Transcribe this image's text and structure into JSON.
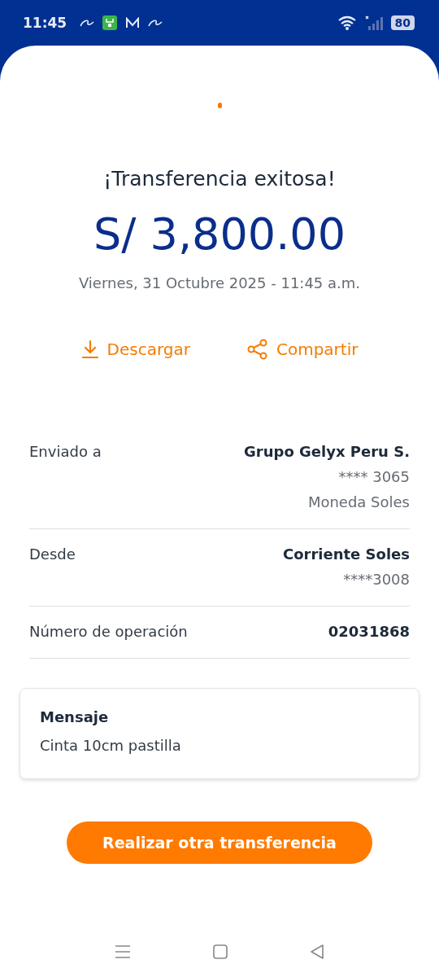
{
  "status_bar": {
    "time": "11:45",
    "battery": "80"
  },
  "title": "¡Transferencia exitosa!",
  "amount": "S/ 3,800.00",
  "date": "Viernes, 31 Octubre 2025 - 11:45 a.m.",
  "actions": [
    {
      "kind": "download",
      "label": "Descargar"
    },
    {
      "kind": "share",
      "label": "Compartir"
    }
  ],
  "details": [
    {
      "label": "Enviado a",
      "values": [
        "Grupo Gelyx Peru S.",
        "**** 3065",
        "Moneda Soles"
      ]
    },
    {
      "label": "Desde",
      "values": [
        "Corriente Soles",
        "****3008"
      ]
    },
    {
      "label": "Número de operación",
      "values": [
        "02031868"
      ]
    }
  ],
  "message": {
    "heading": "Mensaje",
    "text": "Cinta 10cm pastilla"
  },
  "primary_button": "Realizar otra transferencia"
}
